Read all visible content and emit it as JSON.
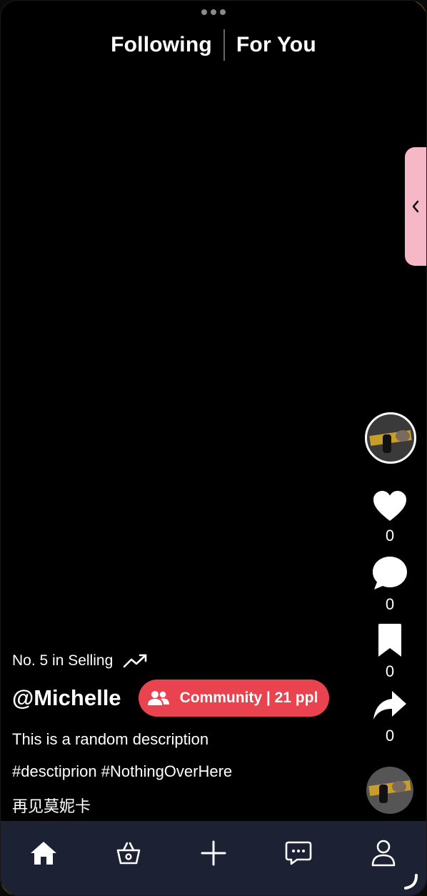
{
  "header": {
    "tabs": [
      {
        "label": "Following"
      },
      {
        "label": "For You"
      }
    ]
  },
  "rail": {
    "like_count": "0",
    "comment_count": "0",
    "bookmark_count": "0",
    "share_count": "0"
  },
  "caption": {
    "rank_text": "No. 5 in Selling",
    "username": "@Michelle",
    "community_label": "Community | 21 ppl",
    "description": "This is a random description",
    "hashtags": "#desctiprion #NothingOverHere",
    "extra_line": "再见莫妮卡"
  },
  "icons": {
    "menu": "more-dots-icon",
    "pull_tab": "chevron-left-icon",
    "like": "heart-icon",
    "comment": "comment-bubble-icon",
    "bookmark": "bookmark-icon",
    "share": "share-arrow-icon",
    "trend": "trending-up-icon",
    "community": "people-icon",
    "nav": [
      "home-icon",
      "basket-icon",
      "plus-icon",
      "chat-icon",
      "profile-icon"
    ]
  },
  "colors": {
    "background": "#000000",
    "community_pill": "#e8434f",
    "side_pull": "#f6b7c7",
    "bottom_nav": "#1c2233",
    "accent_corner": "#d8a321"
  }
}
